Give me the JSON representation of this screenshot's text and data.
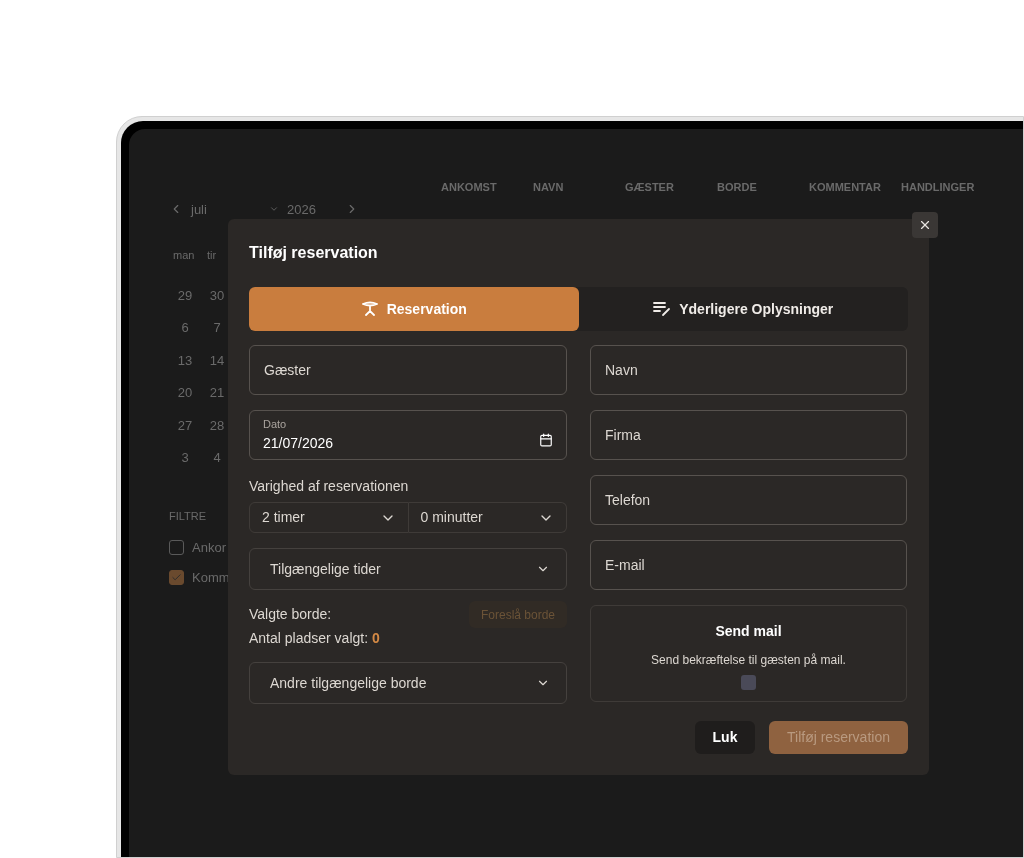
{
  "background": {
    "table": {
      "columns": [
        "ANKOMST",
        "NAVN",
        "GÆSTER",
        "BORDE",
        "KOMMENTAR",
        "HANDLINGER"
      ]
    },
    "calendar": {
      "month": "juli",
      "year": "2026",
      "weekdays": [
        "man",
        "tir"
      ],
      "weeks": [
        [
          "29",
          "30"
        ],
        [
          "6",
          "7"
        ],
        [
          "13",
          "14"
        ],
        [
          "20",
          "21"
        ],
        [
          "27",
          "28"
        ],
        [
          "3",
          "4"
        ]
      ]
    },
    "filters": {
      "title": "FILTRE",
      "items": [
        {
          "label": "Ankor",
          "checked": false
        },
        {
          "label": "Komm",
          "checked": true
        }
      ]
    }
  },
  "dialog": {
    "title": "Tilføj reservation",
    "tabs": [
      {
        "label": "Reservation",
        "selected": true
      },
      {
        "label": "Yderligere Oplysninger",
        "selected": false
      }
    ],
    "guests": {
      "placeholder": "Gæster"
    },
    "date": {
      "label": "Dato",
      "value": "21/07/2026"
    },
    "duration": {
      "label": "Varighed af reservationen",
      "hours": "2 timer",
      "minutes": "0 minutter"
    },
    "times": {
      "label": "Tilgængelige tider",
      "expanded": false
    },
    "selected_tables": {
      "label": "Valgte borde:",
      "suggest": {
        "label": "Foreslå borde",
        "disabled": true
      }
    },
    "seats": {
      "label": "Antal pladser valgt:",
      "count": "0"
    },
    "other_tables": {
      "label": "Andre tilgængelige borde",
      "expanded": false
    },
    "contact_fields": [
      {
        "placeholder": "Navn"
      },
      {
        "placeholder": "Firma"
      },
      {
        "placeholder": "Telefon"
      },
      {
        "placeholder": "E-mail"
      }
    ],
    "send_mail": {
      "title": "Send mail",
      "description": "Send bekræftelse til gæsten på mail.",
      "checked": false
    },
    "buttons": {
      "close": "Luk",
      "submit": {
        "label": "Tilføj reservation",
        "disabled": true
      }
    }
  }
}
